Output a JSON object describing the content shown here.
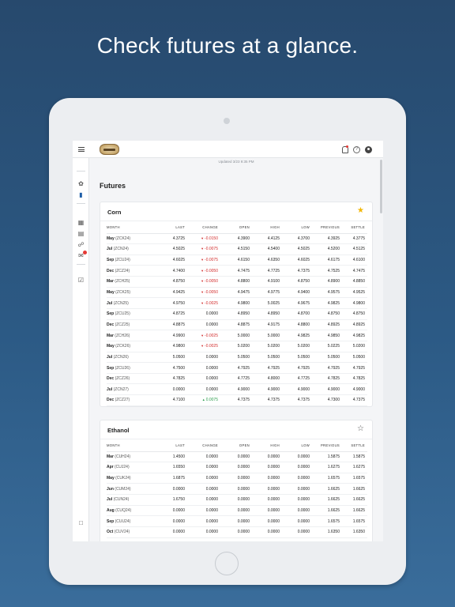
{
  "headline": "Check futures at a glance.",
  "updated_text": "Updated 3/23 9:35 PM",
  "page_title": "Futures",
  "columns": [
    "MONTH",
    "LAST",
    "CHANGE",
    "OPEN",
    "HIGH",
    "LOW",
    "PREVIOUS",
    "SETTLE"
  ],
  "colors": {
    "negative": "#d32f2f",
    "positive": "#2e9e4f",
    "star": "#f2b705",
    "accent": "#1f5fa8"
  },
  "sidebar_icons": [
    "sprout-icon",
    "chart-bars-icon",
    "calendar-icon",
    "book-icon",
    "certificate-icon",
    "mail-icon",
    "checklist-icon",
    "document-icon"
  ],
  "cards": [
    {
      "title": "Corn",
      "favorite": true,
      "rows": [
        {
          "month": "May",
          "code": "(ZCK24)",
          "last": "4.3725",
          "change": "-0.0150",
          "dir": "down",
          "open": "4.3900",
          "high": "4.4125",
          "low": "4.3700",
          "previous": "4.3925",
          "settle": "4.3775"
        },
        {
          "month": "Jul",
          "code": "(ZCN24)",
          "last": "4.5025",
          "change": "-0.0075",
          "dir": "down",
          "open": "4.5150",
          "high": "4.5400",
          "low": "4.5025",
          "previous": "4.5200",
          "settle": "4.5125"
        },
        {
          "month": "Sep",
          "code": "(ZCU24)",
          "last": "4.6025",
          "change": "-0.0075",
          "dir": "down",
          "open": "4.6150",
          "high": "4.6350",
          "low": "4.6025",
          "previous": "4.6175",
          "settle": "4.6100"
        },
        {
          "month": "Dec",
          "code": "(ZCZ24)",
          "last": "4.7400",
          "change": "-0.0050",
          "dir": "down",
          "open": "4.7475",
          "high": "4.7725",
          "low": "4.7375",
          "previous": "4.7525",
          "settle": "4.7475"
        },
        {
          "month": "Mar",
          "code": "(ZCH25)",
          "last": "4.8750",
          "change": "-0.0050",
          "dir": "down",
          "open": "4.8800",
          "high": "4.9100",
          "low": "4.8750",
          "previous": "4.8900",
          "settle": "4.8850"
        },
        {
          "month": "May",
          "code": "(ZCK25)",
          "last": "4.9425",
          "change": "-0.0050",
          "dir": "down",
          "open": "4.9475",
          "high": "4.9775",
          "low": "4.9400",
          "previous": "4.9575",
          "settle": "4.9525"
        },
        {
          "month": "Jul",
          "code": "(ZCN25)",
          "last": "4.9750",
          "change": "-0.0025",
          "dir": "down",
          "open": "4.9800",
          "high": "5.0025",
          "low": "4.9675",
          "previous": "4.9825",
          "settle": "4.9800"
        },
        {
          "month": "Sep",
          "code": "(ZCU25)",
          "last": "4.8725",
          "change": "0.0000",
          "dir": "none",
          "open": "4.8950",
          "high": "4.8950",
          "low": "4.8700",
          "previous": "4.8750",
          "settle": "4.8750"
        },
        {
          "month": "Dec",
          "code": "(ZCZ25)",
          "last": "4.8875",
          "change": "0.0000",
          "dir": "none",
          "open": "4.8875",
          "high": "4.9175",
          "low": "4.8800",
          "previous": "4.8925",
          "settle": "4.8925"
        },
        {
          "month": "Mar",
          "code": "(ZCH26)",
          "last": "4.9900",
          "change": "-0.0025",
          "dir": "down",
          "open": "5.0000",
          "high": "5.0000",
          "low": "4.9825",
          "previous": "4.9850",
          "settle": "4.9825"
        },
        {
          "month": "May",
          "code": "(ZCK26)",
          "last": "4.9800",
          "change": "-0.0025",
          "dir": "down",
          "open": "5.0200",
          "high": "5.0200",
          "low": "5.0200",
          "previous": "5.0225",
          "settle": "5.0200"
        },
        {
          "month": "Jul",
          "code": "(ZCN26)",
          "last": "5.0500",
          "change": "0.0000",
          "dir": "none",
          "open": "5.0500",
          "high": "5.0500",
          "low": "5.0500",
          "previous": "5.0500",
          "settle": "5.0500"
        },
        {
          "month": "Sep",
          "code": "(ZCU26)",
          "last": "4.7500",
          "change": "0.0000",
          "dir": "none",
          "open": "4.7925",
          "high": "4.7925",
          "low": "4.7925",
          "previous": "4.7925",
          "settle": "4.7925"
        },
        {
          "month": "Dec",
          "code": "(ZCZ26)",
          "last": "4.7825",
          "change": "0.0000",
          "dir": "none",
          "open": "4.7725",
          "high": "4.8000",
          "low": "4.7725",
          "previous": "4.7825",
          "settle": "4.7825"
        },
        {
          "month": "Jul",
          "code": "(ZCN27)",
          "last": "0.0000",
          "change": "0.0000",
          "dir": "none",
          "open": "4.9000",
          "high": "4.9000",
          "low": "4.9000",
          "previous": "4.9000",
          "settle": "4.9000"
        },
        {
          "month": "Dec",
          "code": "(ZCZ27)",
          "last": "4.7100",
          "change": "0.0075",
          "dir": "up",
          "open": "4.7375",
          "high": "4.7375",
          "low": "4.7375",
          "previous": "4.7300",
          "settle": "4.7375"
        }
      ]
    },
    {
      "title": "Ethanol",
      "favorite": false,
      "rows": [
        {
          "month": "Mar",
          "code": "(CUH24)",
          "last": "1.4500",
          "change": "0.0000",
          "dir": "none",
          "open": "0.0000",
          "high": "0.0000",
          "low": "0.0000",
          "previous": "1.5875",
          "settle": "1.5875"
        },
        {
          "month": "Apr",
          "code": "(CUJ24)",
          "last": "1.6550",
          "change": "0.0000",
          "dir": "none",
          "open": "0.0000",
          "high": "0.0000",
          "low": "0.0000",
          "previous": "1.6275",
          "settle": "1.6275"
        },
        {
          "month": "May",
          "code": "(CUK24)",
          "last": "1.6875",
          "change": "0.0000",
          "dir": "none",
          "open": "0.0000",
          "high": "0.0000",
          "low": "0.0000",
          "previous": "1.6575",
          "settle": "1.6575"
        },
        {
          "month": "Jun",
          "code": "(CUM24)",
          "last": "0.0000",
          "change": "0.0000",
          "dir": "none",
          "open": "0.0000",
          "high": "0.0000",
          "low": "0.0000",
          "previous": "1.6625",
          "settle": "1.6625"
        },
        {
          "month": "Jul",
          "code": "(CUN24)",
          "last": "1.6750",
          "change": "0.0000",
          "dir": "none",
          "open": "0.0000",
          "high": "0.0000",
          "low": "0.0000",
          "previous": "1.6625",
          "settle": "1.6625"
        },
        {
          "month": "Aug",
          "code": "(CUQ24)",
          "last": "0.0000",
          "change": "0.0000",
          "dir": "none",
          "open": "0.0000",
          "high": "0.0000",
          "low": "0.0000",
          "previous": "1.6625",
          "settle": "1.6625"
        },
        {
          "month": "Sep",
          "code": "(CUU24)",
          "last": "0.0000",
          "change": "0.0000",
          "dir": "none",
          "open": "0.0000",
          "high": "0.0000",
          "low": "0.0000",
          "previous": "1.6575",
          "settle": "1.6575"
        },
        {
          "month": "Oct",
          "code": "(CUV24)",
          "last": "0.0000",
          "change": "0.0000",
          "dir": "none",
          "open": "0.0000",
          "high": "0.0000",
          "low": "0.0000",
          "previous": "1.6350",
          "settle": "1.6350"
        }
      ]
    }
  ]
}
